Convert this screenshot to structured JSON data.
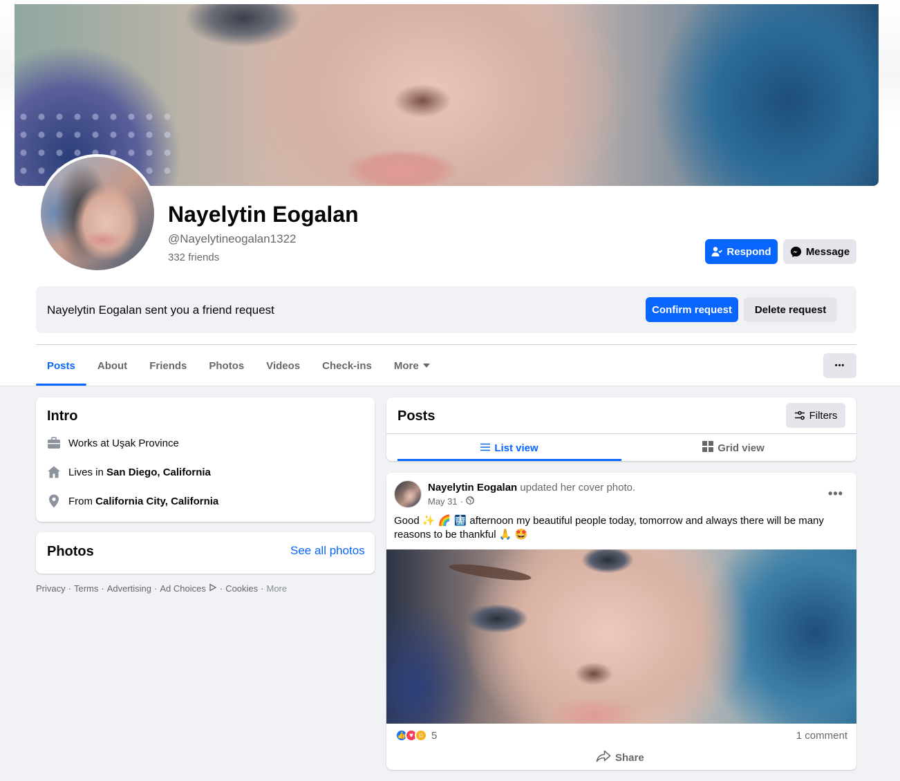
{
  "profile": {
    "name": "Nayelytin Eogalan",
    "handle": "@Nayelytineogalan1322",
    "friends": "332 friends"
  },
  "actions": {
    "respond": "Respond",
    "message": "Message"
  },
  "friend_request": {
    "text": "Nayelytin Eogalan sent you a friend request",
    "confirm": "Confirm request",
    "delete": "Delete request"
  },
  "tabs": [
    {
      "label": "Posts",
      "active": true
    },
    {
      "label": "About"
    },
    {
      "label": "Friends"
    },
    {
      "label": "Photos"
    },
    {
      "label": "Videos"
    },
    {
      "label": "Check-ins"
    },
    {
      "label": "More"
    }
  ],
  "more_button": "•••",
  "intro": {
    "title": "Intro",
    "works_prefix": "Works at ",
    "works_value": "Uşak Province",
    "lives_prefix": "Lives in ",
    "lives_value": "San Diego, California",
    "from_prefix": "From ",
    "from_value": "California City, California"
  },
  "photos": {
    "title": "Photos",
    "see_all": "See all photos"
  },
  "footer": {
    "privacy": "Privacy",
    "terms": "Terms",
    "advertising": "Advertising",
    "ad_choices": "Ad Choices",
    "cookies": "Cookies",
    "more": "More",
    "sep": "·"
  },
  "posts_panel": {
    "title": "Posts",
    "filters": "Filters",
    "list_view": "List view",
    "grid_view": "Grid view"
  },
  "post": {
    "author": "Nayelytin Eogalan",
    "action": " updated her cover photo.",
    "date": "May 31",
    "dot": "·",
    "text": "Good ✨ 🌈 🩻 afternoon my beautiful people today, tomorrow and always there will be many reasons to be thankful 🙏 🤩",
    "reaction_count": "5",
    "comments": "1 comment",
    "share": "Share"
  },
  "colors": {
    "accent": "#0866ff",
    "secondary_bg": "#e4e6eb",
    "page_bg": "#f0f2f5",
    "muted_text": "#65676b"
  },
  "icons": {
    "respond": "person-add-icon",
    "message": "messenger-icon",
    "work": "briefcase-icon",
    "home": "home-icon",
    "location": "pin-icon",
    "filters": "sliders-icon",
    "list": "list-icon",
    "grid": "grid-icon",
    "globe": "globe-icon",
    "share": "share-arrow-icon"
  }
}
